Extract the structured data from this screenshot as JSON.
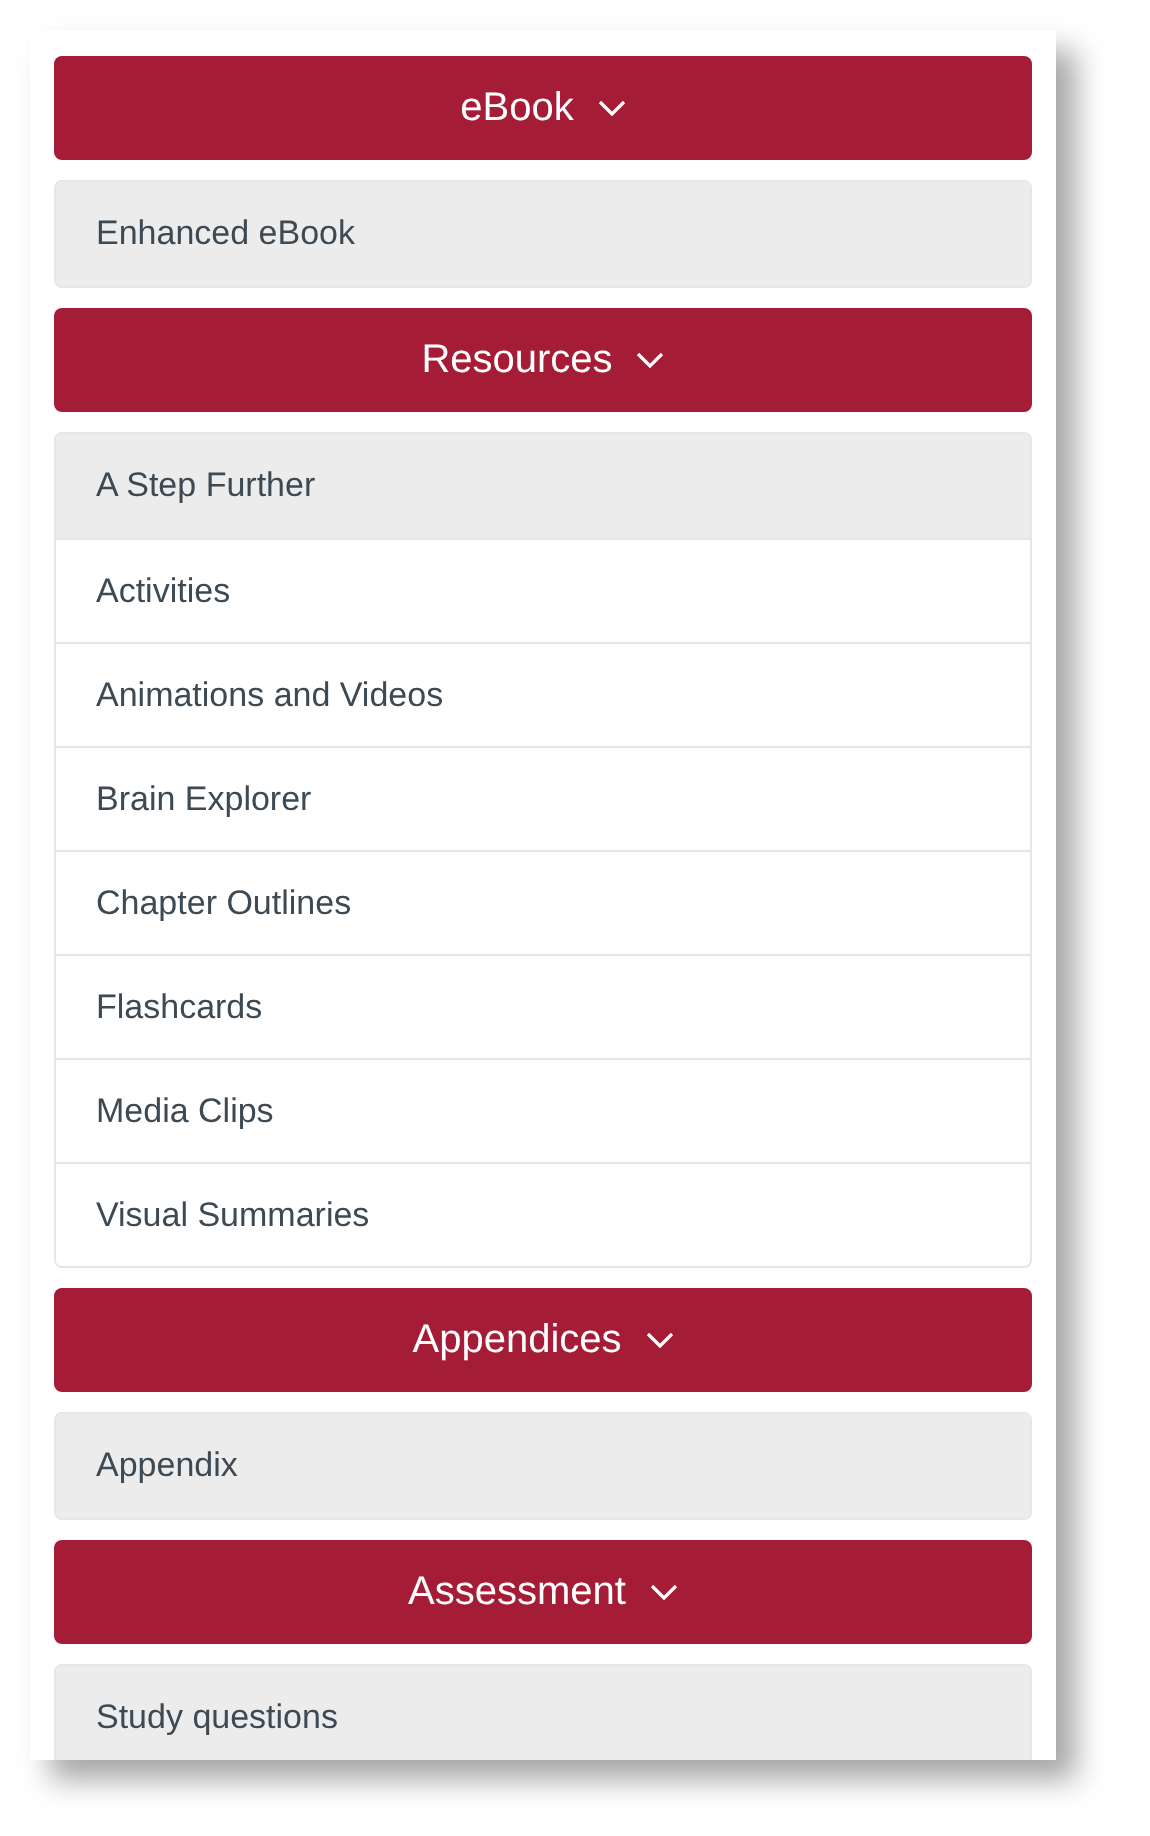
{
  "sections": [
    {
      "title": "eBook",
      "expanded": true,
      "items": [
        {
          "label": "Enhanced eBook",
          "selected": true
        }
      ]
    },
    {
      "title": "Resources",
      "expanded": true,
      "items": [
        {
          "label": "A Step Further",
          "selected": true
        },
        {
          "label": "Activities",
          "selected": false
        },
        {
          "label": "Animations and Videos",
          "selected": false
        },
        {
          "label": "Brain Explorer",
          "selected": false
        },
        {
          "label": "Chapter Outlines",
          "selected": false
        },
        {
          "label": "Flashcards",
          "selected": false
        },
        {
          "label": "Media Clips",
          "selected": false
        },
        {
          "label": "Visual Summaries",
          "selected": false
        }
      ]
    },
    {
      "title": "Appendices",
      "expanded": true,
      "items": [
        {
          "label": "Appendix",
          "selected": true
        }
      ]
    },
    {
      "title": "Assessment",
      "expanded": true,
      "items": [
        {
          "label": "Study questions",
          "selected": true
        }
      ]
    }
  ]
}
